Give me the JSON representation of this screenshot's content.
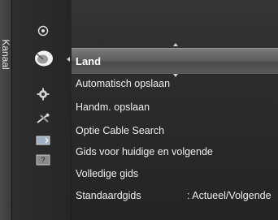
{
  "side_label": "Kanaal",
  "selected_item": "Land",
  "menu_items": [
    "Automatisch opslaan",
    "Handm. opslaan",
    "Optie Cable Search",
    "Gids voor huidige en volgende",
    "Volledige gids",
    "Standaardgids"
  ],
  "standaardgids_value": ": Actueel/Volgende",
  "icons": [
    "speaker-icon",
    "satellite-dish-icon",
    "gear-icon",
    "tools-icon",
    "input-icon",
    "help-icon"
  ]
}
